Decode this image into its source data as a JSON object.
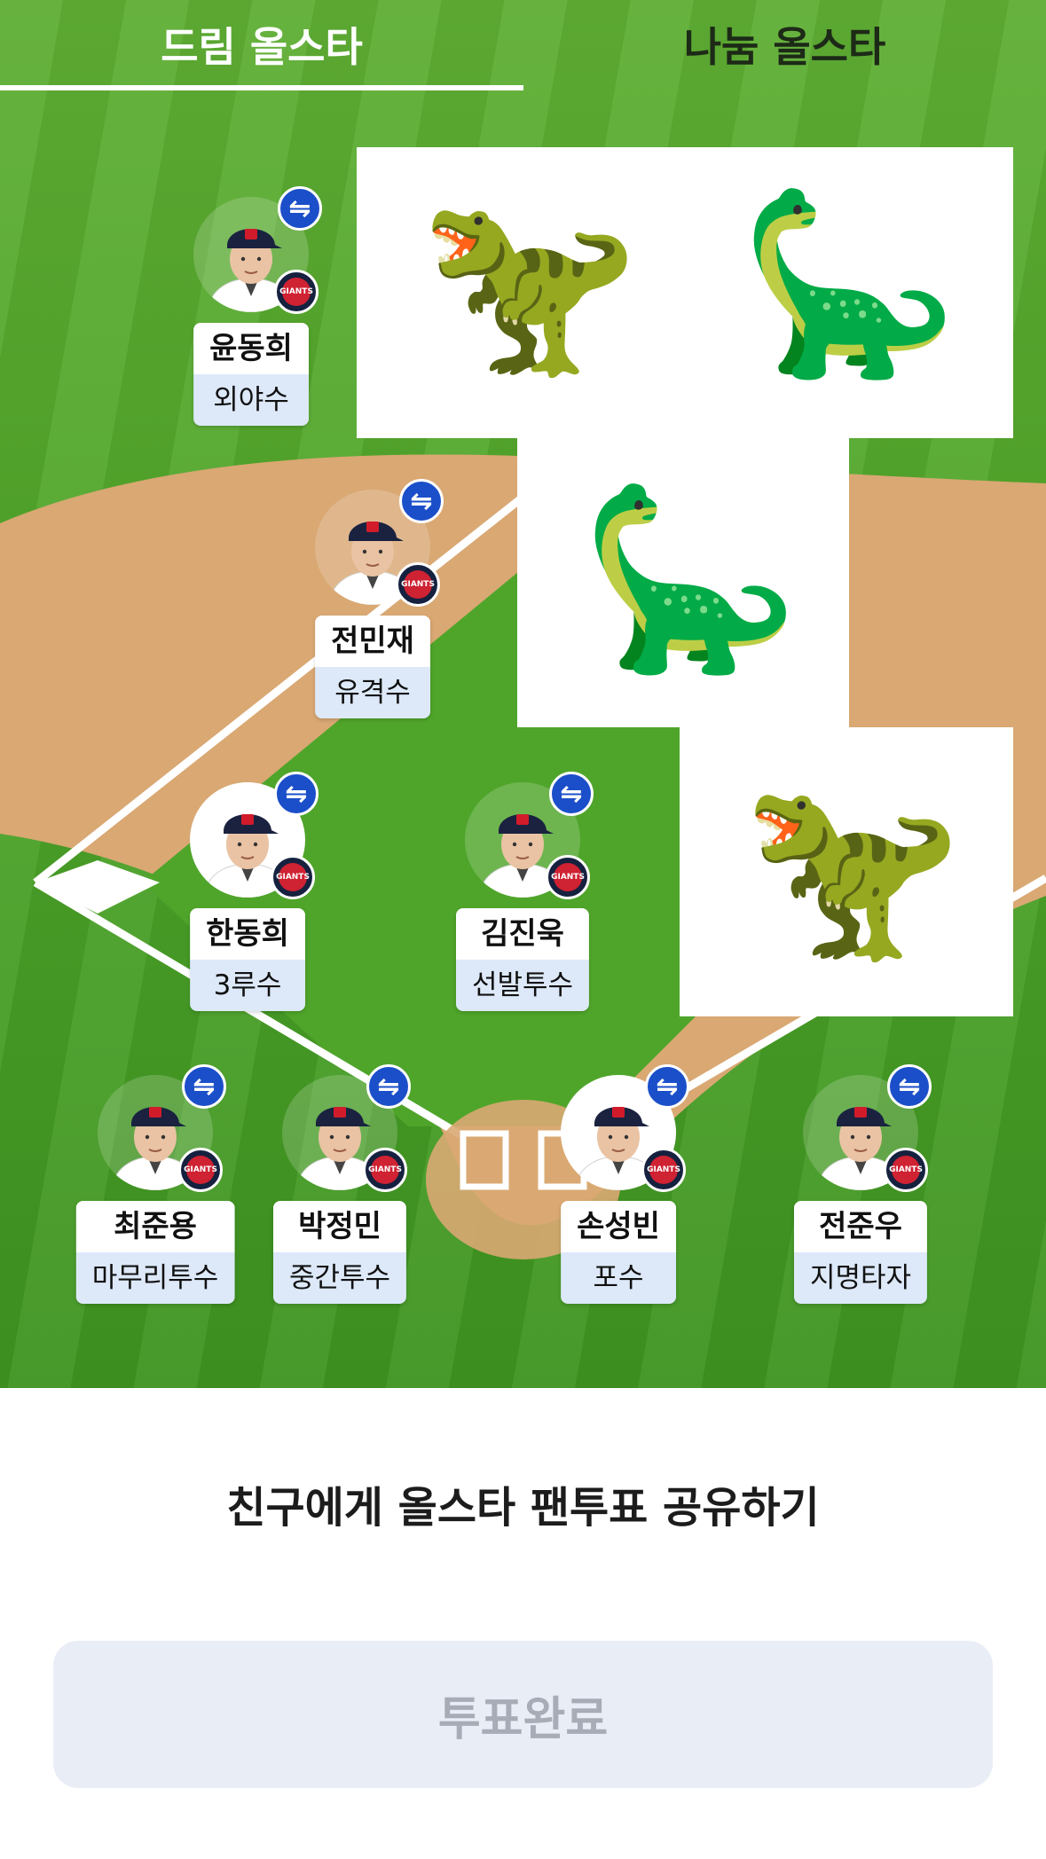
{
  "tabs": [
    {
      "label": "드림 올스타",
      "active": true
    },
    {
      "label": "나눔 올스타",
      "active": false
    }
  ],
  "players": [
    {
      "name": "윤동희",
      "position": "외야수"
    },
    {
      "name": "전민재",
      "position": "유격수"
    },
    {
      "name": "한동희",
      "position": "3루수"
    },
    {
      "name": "김진욱",
      "position": "선발투수"
    },
    {
      "name": "최준용",
      "position": "마무리투수"
    },
    {
      "name": "박정민",
      "position": "중간투수"
    },
    {
      "name": "손성빈",
      "position": "포수"
    },
    {
      "name": "전준우",
      "position": "지명타자"
    }
  ],
  "icons": {
    "swap": "⇋",
    "team_badge_text": "GIANTS",
    "dino_trex": "🦖",
    "dino_sauropod": "🦕"
  },
  "share": {
    "title": "친구에게 올스타 팬투표 공유하기"
  },
  "vote_button": {
    "label": "투표완료",
    "disabled": true
  },
  "colors": {
    "accent_blue": "#1b4fc9",
    "grass": "#4fa52a",
    "dirt": "#d9a873",
    "button_bg": "#e9edf6",
    "button_text": "#a7acb6"
  }
}
